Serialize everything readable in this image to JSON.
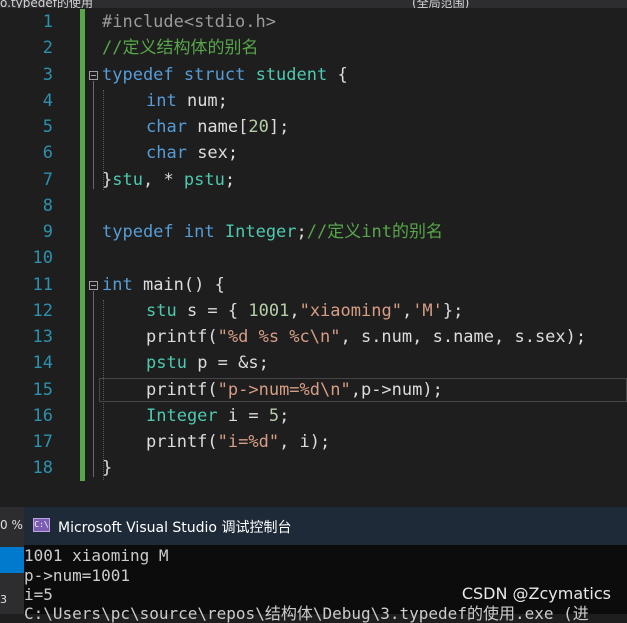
{
  "top": {
    "tab_left": "o.typedef的使用",
    "tab_right": "(全局范围)"
  },
  "editor": {
    "line_numbers": [
      "1",
      "2",
      "3",
      "4",
      "5",
      "6",
      "7",
      "8",
      "9",
      "10",
      "11",
      "12",
      "13",
      "14",
      "15",
      "16",
      "17",
      "18"
    ],
    "lines": {
      "l1_pp": "#include<stdio.h>",
      "l2_cm": "//定义结构体的别名",
      "l3_kw1": "typedef",
      "l3_kw2": "struct",
      "l3_ty": "student",
      "l3_rest": " {",
      "l4_kw": "int",
      "l4_rest": " num;",
      "l5_kw": "char",
      "l5_rest": " name[",
      "l5_num": "20",
      "l5_end": "];",
      "l6_kw": "char",
      "l6_rest": " sex;",
      "l7_a": "}",
      "l7_ty1": "stu",
      "l7_b": ", * ",
      "l7_ty2": "pstu",
      "l7_c": ";",
      "l9_kw1": "typedef",
      "l9_kw2": "int",
      "l9_ty": "Integer",
      "l9_semi": ";",
      "l9_cm": "//定义int的别名",
      "l11_kw": "int",
      "l11_rest": " main() {",
      "l12_ty": "stu",
      "l12_a": " s = { ",
      "l12_num": "1001",
      "l12_b": ",",
      "l12_str1": "\"xiaoming\"",
      "l12_c": ",",
      "l12_str2": "'M'",
      "l12_d": "};",
      "l13_a": "printf(",
      "l13_str": "\"%d %s %c\\n\"",
      "l13_b": ", s.num, s.name, s.sex);",
      "l14_ty": "pstu",
      "l14_rest": " p = &s;",
      "l15_a": "printf(",
      "l15_str": "\"p->num=%d\\n\"",
      "l15_b": ",p->num);",
      "l16_ty": "Integer",
      "l16_rest": " i = ",
      "l16_num": "5",
      "l16_end": ";",
      "l17_a": "printf(",
      "l17_str": "\"i=%d\"",
      "l17_b": ", i);",
      "l18": "}"
    }
  },
  "console": {
    "title": "Microsoft Visual Studio 调试控制台",
    "icon_label": "C:\\",
    "output": [
      "1001 xiaoming M",
      "p->num=1001",
      "i=5",
      "C:\\Users\\pc\\source\\repos\\结构体\\Debug\\3.typedef的使用.exe (进"
    ]
  },
  "left_strip": {
    "zoom": "0 %",
    "tick": "3"
  },
  "watermark": "CSDN @Zcymatics",
  "colors": {
    "keyword": "#569cd6",
    "type": "#4ec9b0",
    "string": "#d69d85",
    "comment": "#57a64a",
    "line_number": "#2b91af"
  }
}
